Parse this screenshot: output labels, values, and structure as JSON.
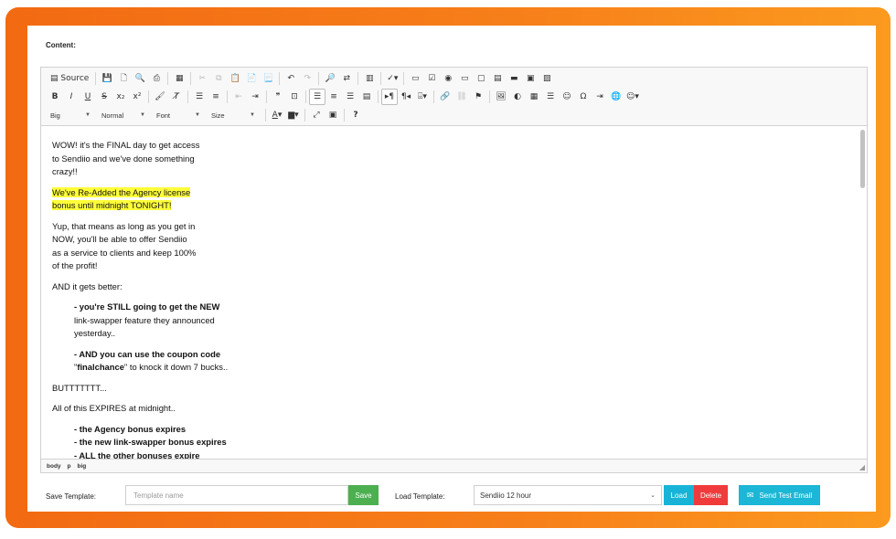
{
  "content_label": "Content:",
  "toolbar": {
    "source_label": "Source",
    "format_combo": "Big",
    "style_combo": "Normal",
    "font_combo": "Font",
    "size_combo": "Size",
    "help_label": "?"
  },
  "editor": {
    "paragraphs": {
      "p1_l1": "WOW! it's the FINAL day to get access",
      "p1_l2": "to Sendiio and we've done something",
      "p1_l3": "crazy!!",
      "p2_l1": "We've Re-Added the Agency license",
      "p2_l2": "bonus until midnight TONIGHT!",
      "p3_l1": "Yup, that means as long as you get in",
      "p3_l2": "NOW, you'll be able to offer Sendiio",
      "p3_l3": "as a service to clients and keep 100%",
      "p3_l4": "of the profit!",
      "p4": "AND it gets better:",
      "p5_l1": "- you're STILL going to get the NEW",
      "p5_l2": "link-swapper feature they announced",
      "p5_l3": "yesterday..",
      "p6_l1": "- AND you can use the coupon code",
      "p6_l2_q1": "\"",
      "p6_l2_code": "finalchance",
      "p6_l2_rest": "\" to knock it down 7 bucks..",
      "p7": "BUTTTTTTT...",
      "p8": "All of this EXPIRES at midnight..",
      "p9_l1": "- the Agency bonus expires",
      "p9_l2": "- the new link-swapper bonus expires",
      "p9_l3": "- ALL the other bonuses expire"
    },
    "status_path": [
      "body",
      "p",
      "big"
    ]
  },
  "footer": {
    "save_template_label": "Save Template:",
    "template_name_placeholder": "Template name",
    "save_button": "Save",
    "load_template_label": "Load Template:",
    "load_select_value": "Sendiio 12 hour",
    "load_button": "Load",
    "delete_button": "Delete",
    "send_test_button": "Send Test Email"
  },
  "colors": {
    "frame_gradient_start": "#f26a12",
    "frame_gradient_end": "#fb9a1f",
    "highlight": "#ffff3a",
    "save_green": "#4caf50",
    "load_cyan": "#17b4d8",
    "delete_red": "#ef3b3b"
  }
}
